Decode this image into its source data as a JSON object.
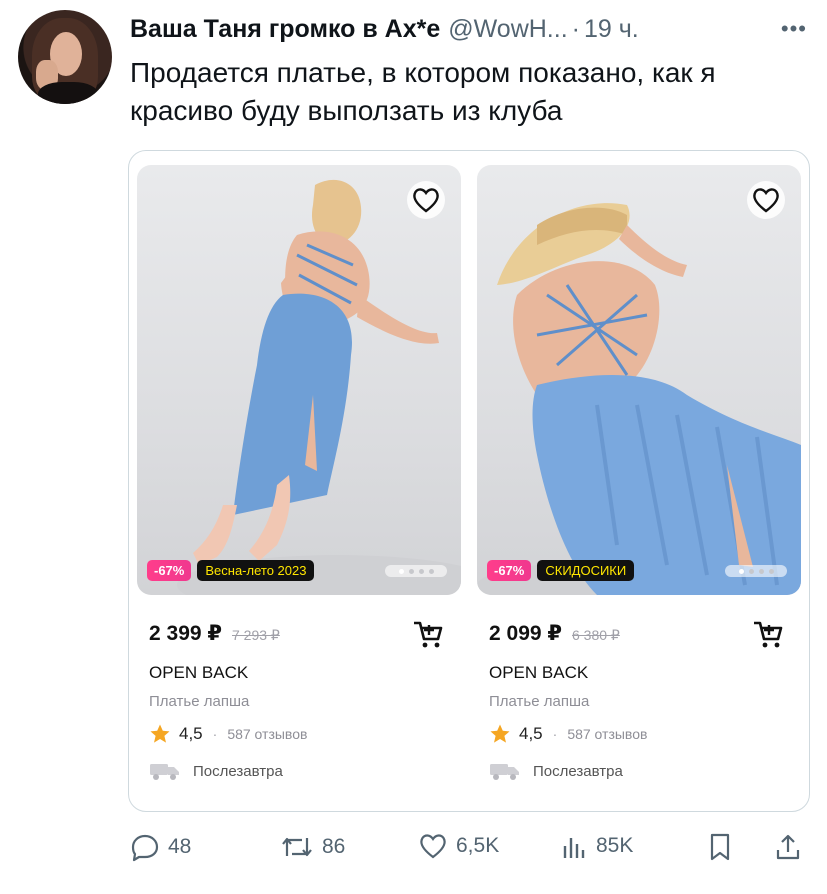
{
  "tweet": {
    "author_name": "Ваша Таня громко в Ах*е",
    "handle": "@WowH...",
    "separator": "·",
    "time": "19 ч.",
    "text": "Продается платье, в котором показано, как я красиво буду выползать из клуба"
  },
  "products": [
    {
      "discount": "-67%",
      "promo": "Весна-лето 2023",
      "price": "2 399 ₽",
      "old_price": "7 293 ₽",
      "brand": "OPEN BACK",
      "name": "Платье лапша",
      "rating": "4,5",
      "rating_sep": "·",
      "reviews": "587 отзывов",
      "delivery": "Послезавтра"
    },
    {
      "discount": "-67%",
      "promo": "СКИДОСИКИ",
      "price": "2 099 ₽",
      "old_price": "6 380 ₽",
      "brand": "OPEN BACK",
      "name": "Платье лапша",
      "rating": "4,5",
      "rating_sep": "·",
      "reviews": "587 отзывов",
      "delivery": "Послезавтра"
    }
  ],
  "actions": {
    "replies": "48",
    "retweets": "86",
    "likes": "6,5K",
    "views": "85K"
  },
  "colors": {
    "accent_text": "#0f1419",
    "muted": "#536471",
    "dress_blue": "#6f9fd6",
    "discount_pink": "#ff3d8b",
    "star": "#f5a623"
  }
}
